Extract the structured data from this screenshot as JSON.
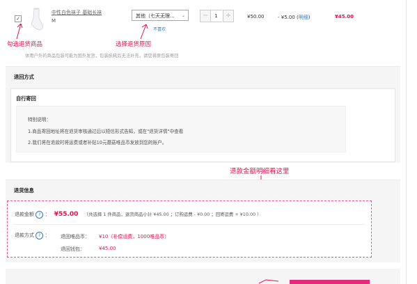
{
  "product": {
    "checkbox_mark": "✓",
    "name": "中性白色袜子 基础长袜",
    "size": "M",
    "reason_selected": "其他（七天无理...",
    "dislike_link": "不喜欢",
    "quantity": "1",
    "qty_minus": "−",
    "qty_plus": "+",
    "price": "¥50.00",
    "discount_prefix": "- ¥5.00 (",
    "discount_link": "明细",
    "discount_suffix": ")",
    "final_price": "¥45.00"
  },
  "annotations": {
    "select_goods": "勾选退货商品",
    "select_reason": "选择退货原因",
    "refund_detail": "退款金额明细看这里"
  },
  "notice": "体用户外的商品包装可能为国外发货，包装损耗后无法补充，请您将原包装寄回",
  "return_method": {
    "title": "退回方式",
    "option": "自行寄回",
    "tips_title": "特别说明：",
    "tips": [
      "1.商品寄回地址将在退货审核通过后以短信形式告知，或在\"退货详情\"中查看",
      "2.我们将在退款时将运费或者补贴10元蘑菇唯品币发放到您的账户。"
    ]
  },
  "refund_info": {
    "title": "退货信息",
    "amount_label": "退款金额",
    "help_glyph": "?",
    "colon": "：",
    "amount": "¥55.00",
    "breakdown": "（共选择 1 件商品，退货商品小计 ¥45.00 ；订购运费 - ¥0.00 ；回寄运费 + ¥10.00 ）",
    "method_label": "退款方式",
    "coin_label": "退回唯品币：",
    "coin_value": "¥10（补偿运费，1000唯品币）",
    "wallet_label": "退回钱包：",
    "wallet_value": "¥45.00"
  },
  "colors": {
    "accent": "#e3124f",
    "link": "#1a7dd7",
    "dash": "#f0509a",
    "button": "#e8277f"
  }
}
